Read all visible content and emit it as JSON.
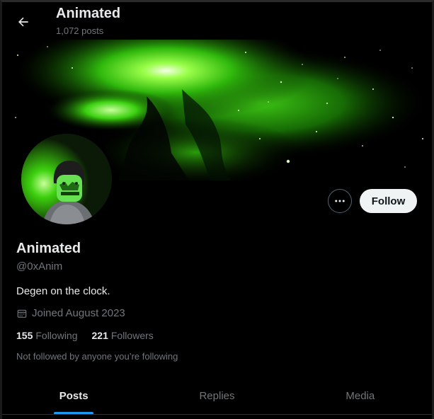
{
  "header": {
    "title": "Animated",
    "post_count": "1,072 posts"
  },
  "profile": {
    "display_name": "Animated",
    "handle": "@0xAnim",
    "bio": "Degen on the clock.",
    "joined": "Joined August 2023",
    "following_count": "155",
    "following_label": "Following",
    "followers_count": "221",
    "followers_label": "Followers",
    "not_followed_note": "Not followed by anyone you’re following"
  },
  "actions": {
    "follow_label": "Follow"
  },
  "tabs": [
    {
      "label": "Posts",
      "active": true
    },
    {
      "label": "Replies",
      "active": false
    },
    {
      "label": "Media",
      "active": false
    }
  ],
  "colors": {
    "background": "#000000",
    "accent": "#1d9bf0",
    "banner_glow": "#39ff14",
    "secondary_text": "#71767b"
  },
  "icons": {
    "back": "arrow-left-icon",
    "more": "more-horizontal-icon",
    "calendar": "calendar-icon"
  }
}
